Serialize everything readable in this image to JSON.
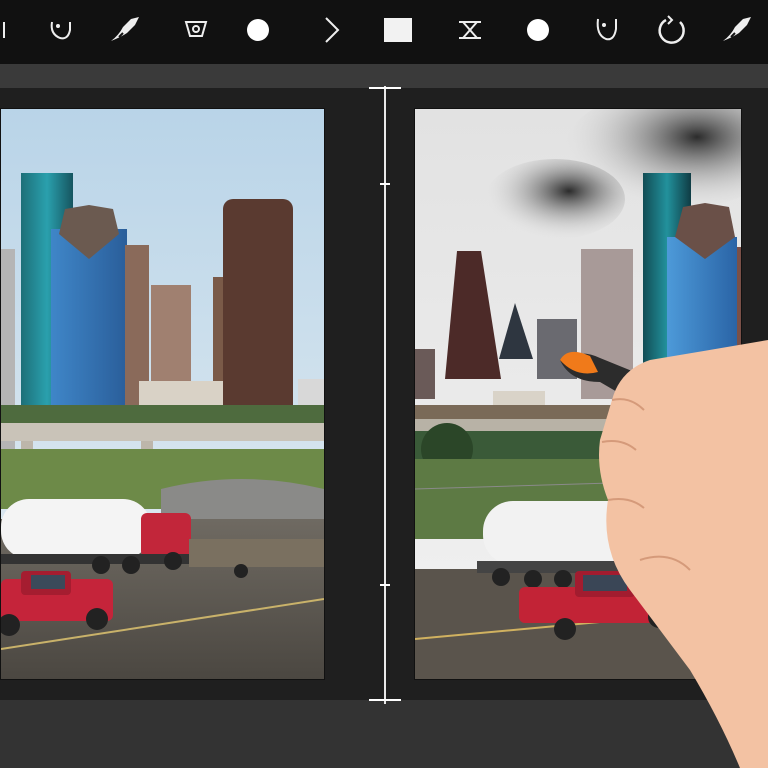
{
  "toolbar": {
    "tools": [
      {
        "icon": "lasso-icon"
      },
      {
        "icon": "brush-stroke-icon"
      },
      {
        "icon": "eye-dropper-icon"
      },
      {
        "icon": "circle-icon"
      },
      {
        "icon": "chevron-right-icon"
      },
      {
        "icon": "square-icon"
      },
      {
        "icon": "crop-cross-icon"
      },
      {
        "icon": "dot-icon"
      },
      {
        "icon": "lasso-icon"
      },
      {
        "icon": "refresh-icon"
      },
      {
        "icon": "brush-stroke-icon"
      }
    ]
  },
  "colors": {
    "toolbar_bg": "#111111",
    "workspace_bg": "#1f1f1f",
    "divider": "#e8e8e8",
    "pen_tip": "#f07a1a"
  },
  "panels": {
    "left": {
      "label": ""
    },
    "right": {
      "label": ""
    }
  }
}
